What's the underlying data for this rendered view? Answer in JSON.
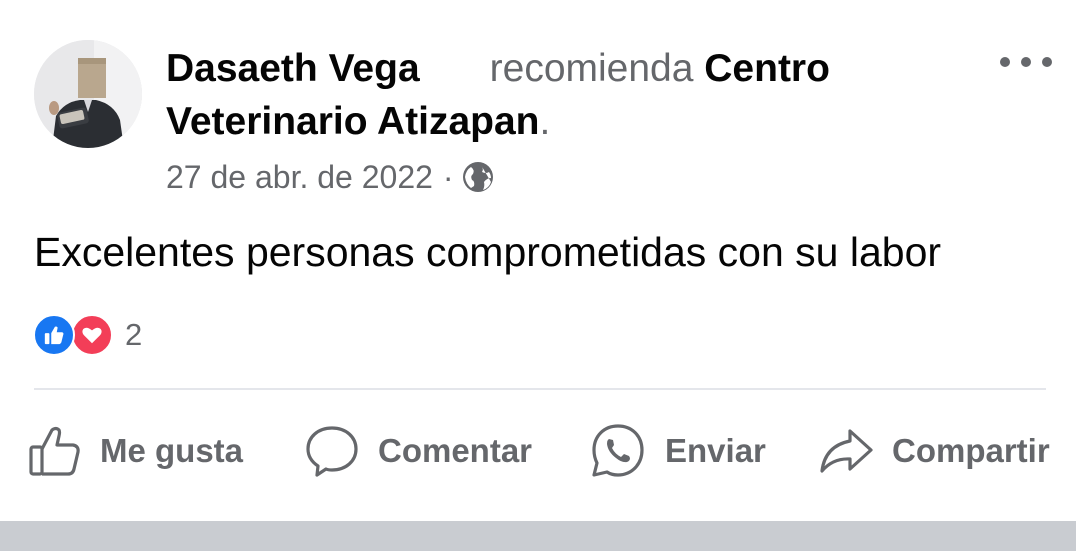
{
  "post": {
    "author_name": "Dasaeth Vega",
    "action_verb": "recomienda",
    "page_name": "Centro Veterinario Atizapan",
    "trailing_period": ".",
    "timestamp": "27 de abr. de 2022",
    "meta_separator": "·",
    "privacy_icon": "globe-icon",
    "body": "Excelentes personas comprometidas con su labor",
    "reactions": {
      "icons": [
        "like-reaction-icon",
        "love-reaction-icon"
      ],
      "count": "2"
    }
  },
  "actions": {
    "like_label": "Me gusta",
    "comment_label": "Comentar",
    "send_label": "Enviar",
    "share_label": "Compartir"
  },
  "colors": {
    "primary_text": "#050505",
    "secondary_text": "#65676b",
    "like_blue": "#1877f2",
    "love_red": "#f33e58",
    "divider": "#e4e6eb"
  }
}
